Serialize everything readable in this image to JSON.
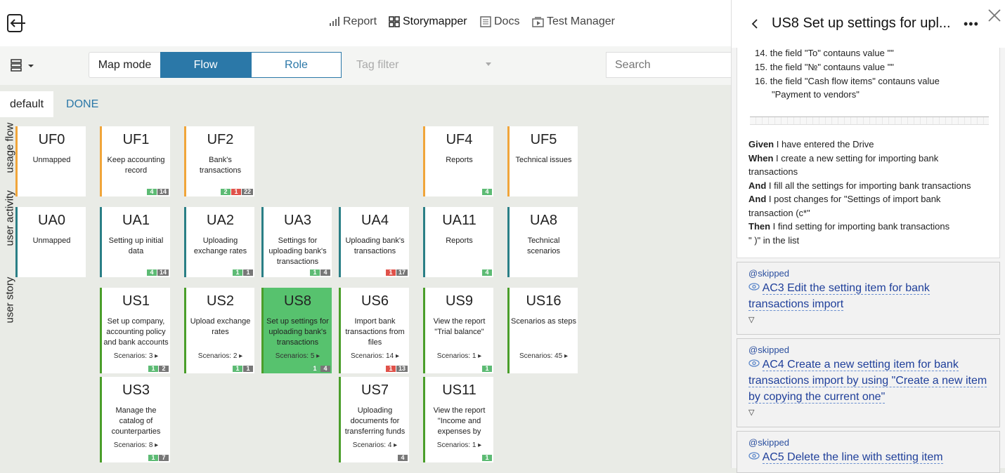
{
  "nav": {
    "report": "Report",
    "storymapper": "Storymapper",
    "docs": "Docs",
    "test_manager": "Test Manager"
  },
  "toolbar": {
    "map_mode": "Map mode",
    "flow": "Flow",
    "role": "Role",
    "tag_filter": "Tag filter",
    "search_placeholder": "Search"
  },
  "tabs": [
    "default",
    "DONE"
  ],
  "rows": {
    "usage_flow": "usage flow",
    "user_activity": "user activity",
    "user_story": "user story"
  },
  "cards": {
    "uf0": {
      "id": "UF0",
      "desc": "Unmapped",
      "scen": "",
      "badges": []
    },
    "uf1": {
      "id": "UF1",
      "desc": "Keep accounting record",
      "scen": "",
      "badges": [
        [
          "g",
          "4"
        ],
        [
          "d",
          "14"
        ]
      ]
    },
    "uf2": {
      "id": "UF2",
      "desc": "Bank's transactions",
      "scen": "",
      "badges": [
        [
          "g",
          "2"
        ],
        [
          "r",
          "1"
        ],
        [
          "d",
          "22"
        ]
      ]
    },
    "uf4": {
      "id": "UF4",
      "desc": "Reports",
      "scen": "",
      "badges": [
        [
          "g",
          "4"
        ]
      ]
    },
    "uf5": {
      "id": "UF5",
      "desc": "Technical issues",
      "scen": "",
      "badges": []
    },
    "ua0": {
      "id": "UA0",
      "desc": "Unmapped",
      "scen": "",
      "badges": []
    },
    "ua1": {
      "id": "UA1",
      "desc": "Setting up initial data",
      "scen": "",
      "badges": [
        [
          "g",
          "4"
        ],
        [
          "d",
          "14"
        ]
      ]
    },
    "ua2": {
      "id": "UA2",
      "desc": "Uploading exchange rates",
      "scen": "",
      "badges": [
        [
          "g",
          "1"
        ],
        [
          "d",
          "1"
        ]
      ]
    },
    "ua3": {
      "id": "UA3",
      "desc": "Settings for uploading bank's transactions",
      "scen": "",
      "badges": [
        [
          "g",
          "1"
        ],
        [
          "d",
          "4"
        ]
      ]
    },
    "ua4": {
      "id": "UA4",
      "desc": "Uploading bank's transactions",
      "scen": "",
      "badges": [
        [
          "r",
          "1"
        ],
        [
          "d",
          "17"
        ]
      ]
    },
    "ua11": {
      "id": "UA11",
      "desc": "Reports",
      "scen": "",
      "badges": [
        [
          "g",
          "4"
        ]
      ]
    },
    "ua8": {
      "id": "UA8",
      "desc": "Technical scenarios",
      "scen": "",
      "badges": []
    },
    "us1": {
      "id": "US1",
      "desc": "Set up company, accounting policy and bank accounts",
      "scen": "Scenarios: 3 ▸",
      "badges": [
        [
          "g",
          "1"
        ],
        [
          "d",
          "2"
        ]
      ]
    },
    "us2": {
      "id": "US2",
      "desc": "Upload exchange rates",
      "scen": "Scenarios: 2 ▸",
      "badges": [
        [
          "g",
          "1"
        ],
        [
          "d",
          "1"
        ]
      ]
    },
    "us8": {
      "id": "US8",
      "desc": "Set up settings for uploading bank's transactions",
      "scen": "Scenarios: 5 ▸",
      "badges": [
        [
          "g",
          "1"
        ],
        [
          "d",
          "4"
        ]
      ]
    },
    "us6": {
      "id": "US6",
      "desc": "Import bank transactions from files",
      "scen": "Scenarios: 14 ▸",
      "badges": [
        [
          "r",
          "1"
        ],
        [
          "d",
          "13"
        ]
      ]
    },
    "us9": {
      "id": "US9",
      "desc": "View the report \"Trial balance\"",
      "scen": "Scenarios: 1 ▸",
      "badges": [
        [
          "g",
          "1"
        ]
      ]
    },
    "us16": {
      "id": "US16",
      "desc": "Scenarios as steps",
      "scen": "Scenarios: 45 ▸",
      "badges": []
    },
    "us3": {
      "id": "US3",
      "desc": "Manage the catalog of counterparties",
      "scen": "Scenarios: 8 ▸",
      "badges": [
        [
          "g",
          "1"
        ],
        [
          "d",
          "7"
        ]
      ]
    },
    "us7": {
      "id": "US7",
      "desc": "Uploading documents for transferring funds between accounts",
      "scen": "Scenarios: 4 ▸",
      "badges": [
        [
          "d",
          "4"
        ]
      ]
    },
    "us11": {
      "id": "US11",
      "desc": "View the report \"Income and expenses by project\"",
      "scen": "Scenarios: 1 ▸",
      "badges": [
        [
          "g",
          "1"
        ]
      ]
    }
  },
  "panel": {
    "title": "US8 Set up settings for upl...",
    "more": "•••",
    "steps": [
      {
        "n": "14.",
        "t": "the field \"To\" contauns value \"\""
      },
      {
        "n": "15.",
        "t": "the field \"№\" contauns value \"\""
      },
      {
        "n": "16.",
        "t": "the field \"Cash flow items\" contauns value"
      },
      {
        "n": "",
        "t": "\"Payment to vendors\""
      }
    ],
    "gherkin": [
      {
        "k": "Given",
        "t": " I have entered the Drive"
      },
      {
        "k": "When",
        "t": " I create a new setting for importing bank"
      },
      {
        "k": "",
        "t": "transactions"
      },
      {
        "k": "And",
        "t": " I fill all the settings for importing bank transactions"
      },
      {
        "k": "And",
        "t": " I post changes for \"Settings of import bank"
      },
      {
        "k": "",
        "t": "transaction (c*\""
      },
      {
        "k": "Then",
        "t": " I find setting for importing bank transactions"
      },
      {
        "k": "",
        "t": "\"            )\" in the list"
      }
    ],
    "acs": [
      {
        "tag": "@skipped",
        "l1": "AC3 Edit the setting item for bank",
        "l2": "transactions import",
        "l3": ""
      },
      {
        "tag": "@skipped",
        "l1": "AC4 Create a new setting item for bank",
        "l2": "transactions import by using \"Create a new item",
        "l3": "by copying the current one\""
      },
      {
        "tag": "@skipped",
        "l1": "AC5 Delete the line with setting item",
        "l2": "",
        "l3": ""
      }
    ]
  }
}
